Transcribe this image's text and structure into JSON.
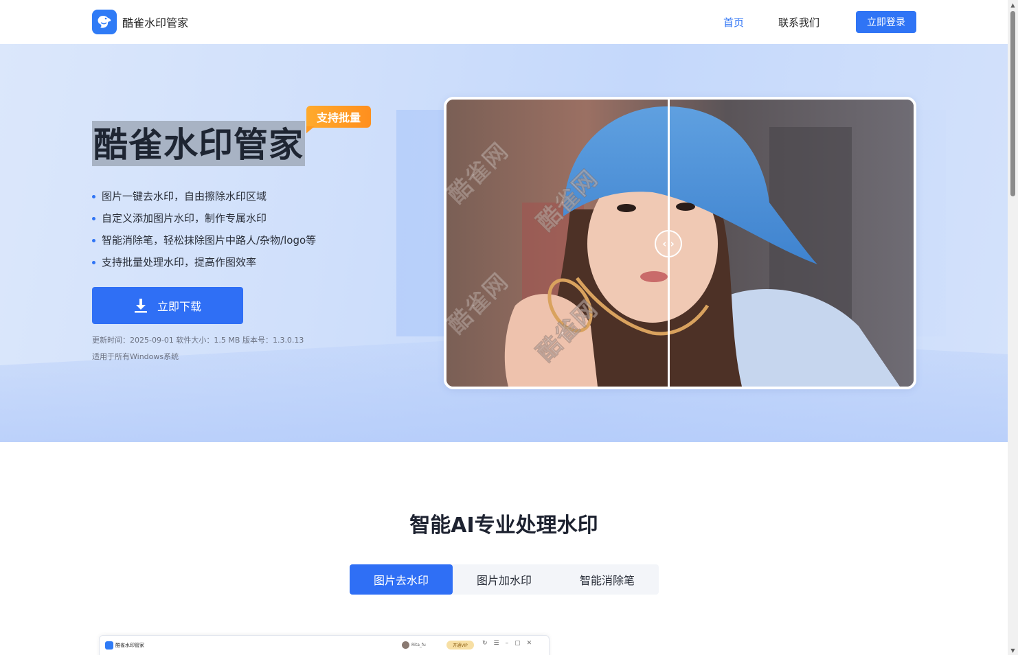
{
  "header": {
    "app_name": "酷雀水印管家",
    "nav_home": "首页",
    "nav_contact": "联系我们",
    "login": "立即登录"
  },
  "hero": {
    "title": "酷雀水印管家",
    "badge": "支持批量",
    "features": [
      "图片一键去水印，自由擦除水印区域",
      "自定义添加图片水印，制作专属水印",
      "智能消除笔，轻松抹除图片中路人/杂物/logo等",
      "支持批量处理水印，提高作图效率"
    ],
    "download": "立即下载",
    "meta_line1": "更新时间：2025-09-01  软件大小：1.5 MB  版本号：1.3.0.13",
    "meta_line2": "适用于所有Windows系统",
    "compare_handle": "‹ ›",
    "watermark": "酷雀网"
  },
  "section": {
    "title": "智能AI专业处理水印",
    "tabs": [
      "图片去水印",
      "图片加水印",
      "智能消除笔"
    ],
    "active_tab": 0
  },
  "app_preview": {
    "title": "酷雀水印管家",
    "user": "Rita_fu",
    "vip": "开通VIP",
    "controls": "↻☰–▢✕"
  },
  "colors": {
    "accent": "#2f74f5",
    "badge": "#ff9a22"
  }
}
